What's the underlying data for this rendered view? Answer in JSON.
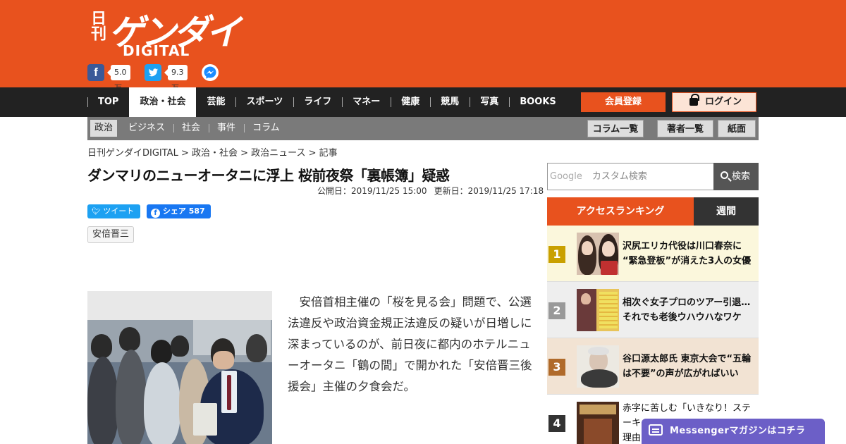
{
  "header": {
    "logo_nikkan": "日刊",
    "logo_main": "ゲンダイ",
    "logo_sub": "DIGITAL",
    "facebook_count": "5.0万",
    "twitter_count": "9.3万",
    "brand_color": "#e8521e"
  },
  "nav": {
    "items": [
      "TOP",
      "政治・社会",
      "芸能",
      "スポーツ",
      "ライフ",
      "マネー",
      "健康",
      "競馬",
      "写真",
      "BOOKS"
    ],
    "active_index": 1,
    "register_label": "会員登録",
    "login_label": "ログイン"
  },
  "subnav": {
    "items": [
      "政治",
      "ビジネス",
      "社会",
      "事件",
      "コラム"
    ],
    "buttons": [
      "コラム一覧",
      "著者一覧",
      "紙面"
    ]
  },
  "breadcrumb": "日刊ゲンダイDIGITAL > 政治・社会 > 政治ニュース > 記事",
  "article": {
    "title": "ダンマリのニューオータニに浮上 桜前夜祭「裏帳簿」疑惑",
    "published": "公開日：2019/11/25 15:00",
    "updated": "更新日：2019/11/25 17:18",
    "tweet_label": "ツイート",
    "share_label": "シェア",
    "share_count": "587",
    "tag": "安倍晋三",
    "body": "安倍首相主催の「桜を見る会」問題で、公選法違反や政治資金規正法違反の疑いが日増しに深まっているのが、前日夜に都内のホテルニューオータニ「鶴の間」で開かれた「安倍晋三後援会」主催の夕食会だ。"
  },
  "search": {
    "google_label": "Google",
    "placeholder": "カスタム検索",
    "button_label": "検索"
  },
  "ranking": {
    "tab_active": "アクセスランキング",
    "tab_other": "週間",
    "items": [
      {
        "num": "1",
        "line1": "沢尻エリカ代役は川口春奈に",
        "line2": "“緊急登板”が消えた3人の女優",
        "color": "#c9a000",
        "bg": "#fbf7dc"
      },
      {
        "num": "2",
        "line1": "相次ぐ女子プロのツアー引退…",
        "line2": "それでも老後ウハウハなワケ",
        "color": "#999999",
        "bg": "#eeeeee"
      },
      {
        "num": "3",
        "line1": "谷口源太郎氏 東京大会で“五輪",
        "line2": "は不要”の声が広がればいい",
        "color": "#b06a2a",
        "bg": "#f2e3d3"
      },
      {
        "num": "4",
        "line1": "赤字に苦しむ「いきなり！ステ",
        "line2": "ーキ",
        "line3": "理由",
        "color": "#333333",
        "bg": "#ffffff"
      }
    ]
  },
  "messenger": {
    "label": "Messengerマガジンはコチラ"
  }
}
